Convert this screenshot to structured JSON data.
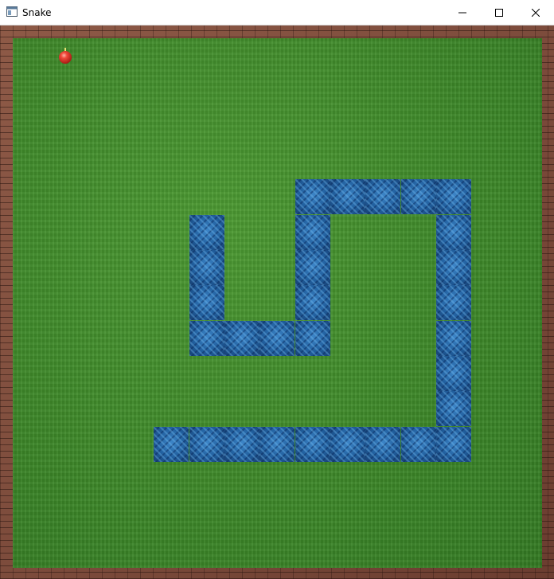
{
  "window": {
    "title": "Snake",
    "controls": {
      "minimize": "minimize",
      "maximize": "maximize",
      "close": "close"
    }
  },
  "game": {
    "grid": {
      "cols": 15,
      "rows": 15
    },
    "food": {
      "col": 1,
      "row": 0,
      "color": "#e8463a"
    },
    "snake": {
      "color": "#1e5a98",
      "body": [
        [
          5,
          5
        ],
        [
          5,
          6
        ],
        [
          5,
          7
        ],
        [
          5,
          8
        ],
        [
          6,
          8
        ],
        [
          7,
          8
        ],
        [
          8,
          8
        ],
        [
          8,
          7
        ],
        [
          8,
          6
        ],
        [
          8,
          5
        ],
        [
          8,
          4
        ],
        [
          9,
          4
        ],
        [
          10,
          4
        ],
        [
          11,
          4
        ],
        [
          12,
          4
        ],
        [
          12,
          5
        ],
        [
          12,
          6
        ],
        [
          12,
          7
        ],
        [
          12,
          8
        ],
        [
          12,
          9
        ],
        [
          12,
          10
        ],
        [
          12,
          11
        ],
        [
          11,
          11
        ],
        [
          10,
          11
        ],
        [
          9,
          11
        ],
        [
          8,
          11
        ],
        [
          7,
          11
        ],
        [
          6,
          11
        ],
        [
          5,
          11
        ],
        [
          4,
          11
        ]
      ]
    },
    "colors": {
      "grass": "#3f8a2a",
      "wall": "#7a4a3a"
    }
  }
}
